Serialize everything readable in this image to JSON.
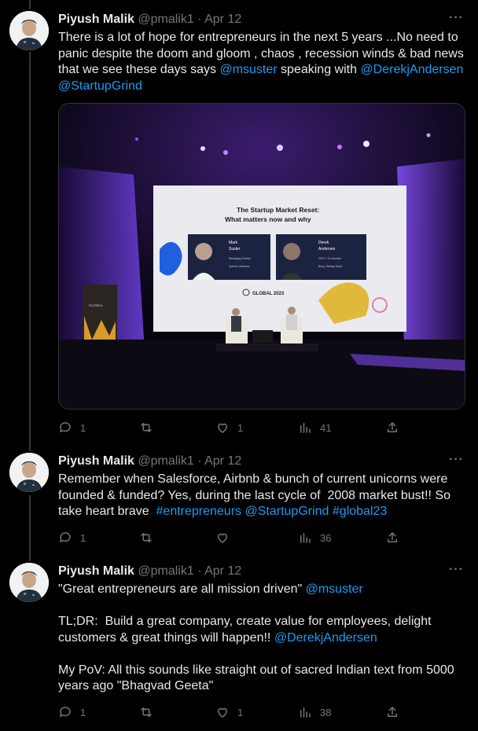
{
  "tweets": [
    {
      "author": {
        "name": "Piyush Malik",
        "handle": "@pmalik1"
      },
      "date": "Apr 12",
      "body": [
        {
          "t": "There is a lot of hope for entrepreneurs in the next 5 years ...No need to panic despite the doom and gloom , chaos , recession winds & bad news that we see these days says "
        },
        {
          "t": "@msuster",
          "link": true
        },
        {
          "t": " speaking with "
        },
        {
          "t": "@DerekjAndersen",
          "link": true
        },
        {
          "t": "\n"
        },
        {
          "t": "@StartupGrind",
          "link": true
        }
      ],
      "media": {
        "slide_title": "The Startup Market Reset:",
        "slide_subtitle": "What matters now and why",
        "speaker1": {
          "first": "Mark",
          "last": "Suster",
          "role": "Managing Partner",
          "org": "Upfront Ventures"
        },
        "speaker2": {
          "first": "Derek",
          "last": "Andersen",
          "role": "CEO + Co-founder",
          "org": "Bevy, Startup Grind"
        },
        "event": "GLOBAL 2023",
        "podium": "GLOBAL"
      },
      "actions": {
        "replies": "1",
        "retweets": "",
        "likes": "1",
        "views": "41"
      }
    },
    {
      "author": {
        "name": "Piyush Malik",
        "handle": "@pmalik1"
      },
      "date": "Apr 12",
      "body": [
        {
          "t": "Remember when Salesforce, Airbnb & bunch of current unicorns were founded & funded? Yes, during the last cycle of  2008 market bust!! So take heart brave  "
        },
        {
          "t": "#entrepreneurs",
          "link": true
        },
        {
          "t": " "
        },
        {
          "t": "@StartupGrind",
          "link": true
        },
        {
          "t": " "
        },
        {
          "t": "#global23",
          "link": true
        }
      ],
      "actions": {
        "replies": "1",
        "retweets": "",
        "likes": "",
        "views": "36"
      }
    },
    {
      "author": {
        "name": "Piyush Malik",
        "handle": "@pmalik1"
      },
      "date": "Apr 12",
      "body": [
        {
          "t": "\"Great entrepreneurs are all mission driven\" "
        },
        {
          "t": "@msuster",
          "link": true
        },
        {
          "t": "\n\nTL;DR:  Build a great company, create value for employees, delight customers & great things will happen!! "
        },
        {
          "t": "@DerekjAndersen",
          "link": true
        },
        {
          "t": "\n\nMy PoV: All this sounds like straight out of sacred Indian text from 5000 years ago \"Bhagvad Geeta\""
        }
      ],
      "actions": {
        "replies": "1",
        "retweets": "",
        "likes": "1",
        "views": "38"
      }
    }
  ],
  "icons": {
    "reply": "speech-bubble-icon",
    "retweet": "retweet-icon",
    "like": "heart-icon",
    "views": "bar-chart-icon",
    "share": "share-icon",
    "more": "more-dots-icon"
  },
  "colors": {
    "background": "#000000",
    "text": "#e7e9ea",
    "muted": "#71767b",
    "link": "#1d9bf0"
  },
  "more_label": "···"
}
